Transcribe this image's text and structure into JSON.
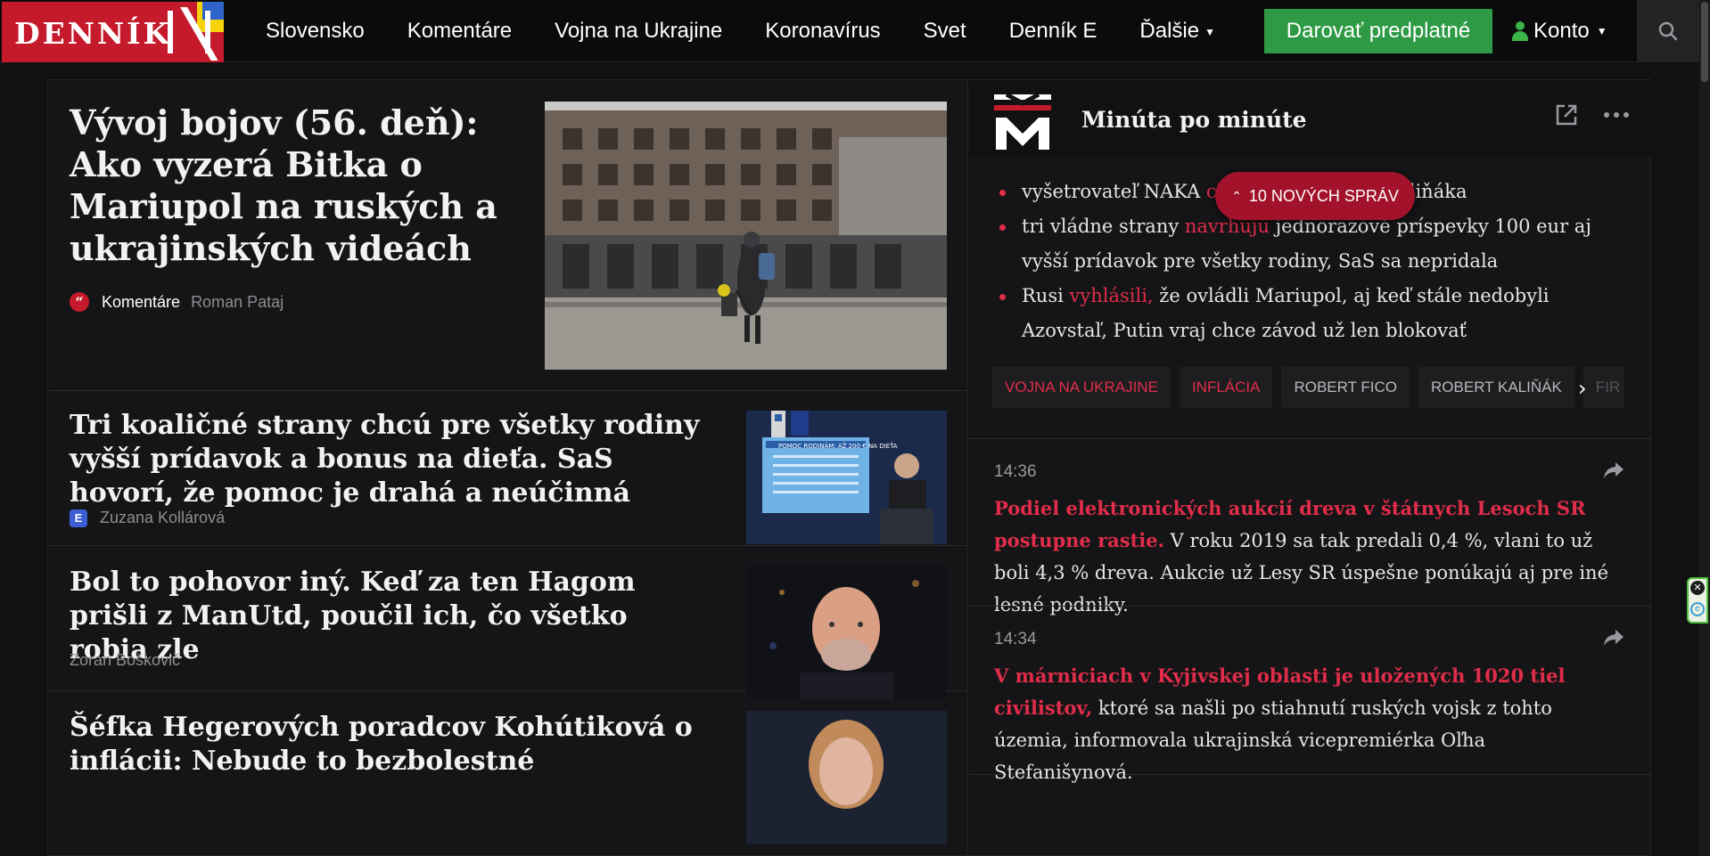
{
  "brand": {
    "name": "DENNÍK"
  },
  "nav": {
    "items": [
      "Slovensko",
      "Komentáre",
      "Vojna na Ukrajine",
      "Koronavírus",
      "Svet",
      "Denník E"
    ],
    "more_label": "Ďalšie",
    "donate_label": "Darovať predplatné",
    "account_label": "Konto"
  },
  "articles": [
    {
      "title": "Vývoj bojov (56. deň): Ako vyzerá Bitka o Mariupol na ruských a ukrajinských videách",
      "section": "Komentáre",
      "author": "Roman Pataj"
    },
    {
      "title": "Tri koaličné strany chcú pre všetky rodiny vyšší prídavok a bonus na dieťa. SaS hovorí, že pomoc je drahá a neúčinná",
      "author": "Zuzana Kollárová",
      "image_caption": "POMOC RODINÁM: AŽ 200 € NA DIEŤA"
    },
    {
      "title": "Bol to pohovor iný. Keď za ten Hagom prišli z ManUtd, poučil ich, čo všetko robia zle",
      "author": "Zoran Boškovič"
    },
    {
      "title": "Šéfka Hegerových poradcov Kohútiková o inflácii: Nebude to bezbolestné"
    }
  ],
  "live": {
    "title": "Minúta po minúte",
    "new_messages": "10 NOVÝCH SPRÁV",
    "bullets": [
      {
        "before": "vyšetrovateľ NAKA ",
        "link": "ch",
        "after": "aliňáka"
      },
      {
        "before": "tri vládne strany ",
        "link": "navrhujú",
        "after": " jednorazové príspevky 100 eur aj vyšší prídavok pre všetky rodiny, SaS sa nepridala"
      },
      {
        "before": "Rusi ",
        "link": "vyhlásili,",
        "after": " že ovládli Mariupol, aj keď stále nedobyli Azovstaľ, Putin vraj chce závod už len blokovať"
      }
    ],
    "tags": [
      "VOJNA NA UKRAJINE",
      "INFLÁCIA",
      "ROBERT FICO",
      "ROBERT KALIŇÁK",
      "FIR"
    ],
    "entries": [
      {
        "time": "14:36",
        "lead": "Podiel elektronických aukcií dreva v štátnych Lesoch SR postupne rastie.",
        "body": " V roku 2019 sa tak predali 0,4 %, vlani to už boli 4,3 % dreva. Aukcie už Lesy SR úspešne ponúkajú aj pre iné lesné podniky."
      },
      {
        "time": "14:34",
        "lead": "V márniciach v Kyjivskej oblasti je uložených 1020 tiel civilistov,",
        "body": " ktoré sa našli po stiahnutí ruských vojsk z tohto územia, informovala ukrajinská vicepremiérka Oľha Stefanišynová."
      }
    ]
  },
  "colors": {
    "brand_red": "#c51a2b",
    "accent_red": "#e02d49",
    "donate_green": "#2e9a45",
    "background": "#111113"
  }
}
